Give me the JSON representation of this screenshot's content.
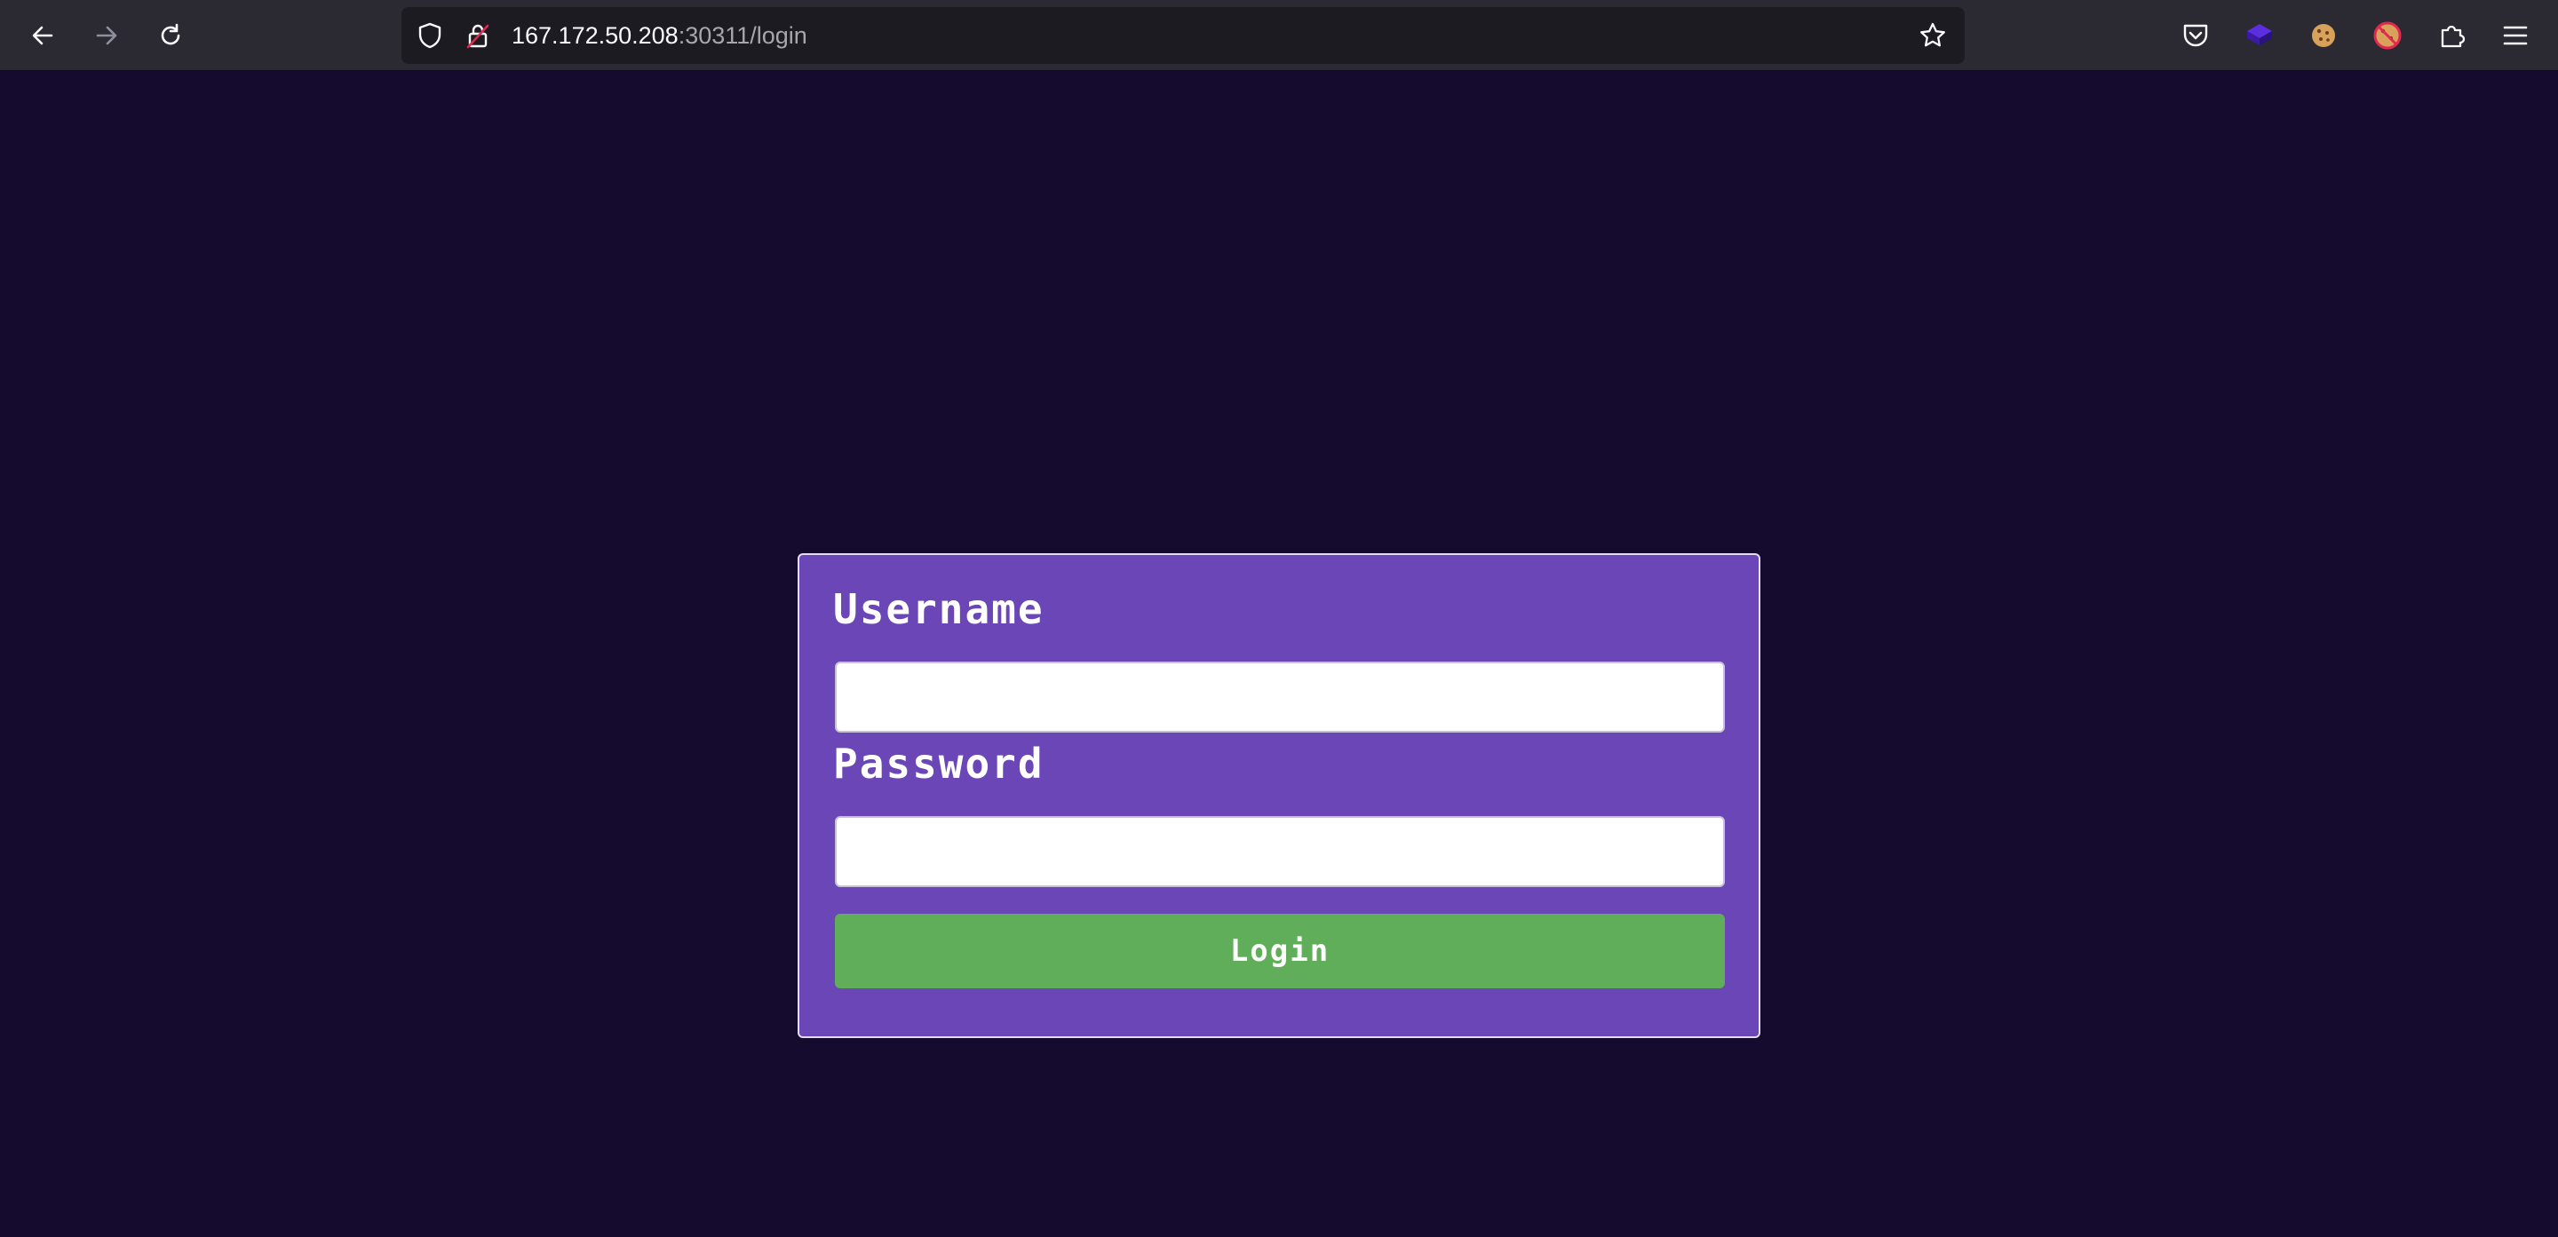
{
  "browser": {
    "url_host": "167.172.50.208",
    "url_rest": ":30311/login",
    "icons": {
      "back": "back-arrow-icon",
      "forward": "forward-arrow-icon",
      "reload": "reload-icon",
      "shield": "tracking-protection-shield-icon",
      "lock": "insecure-lock-icon",
      "bookmark": "bookmark-star-icon",
      "pocket": "pocket-icon",
      "extensions": [
        "extension-cube-icon",
        "cookie-icon",
        "cookie-blocked-icon",
        "extensions-puzzle-icon"
      ],
      "menu": "hamburger-menu-icon"
    }
  },
  "login": {
    "username_label": "Username",
    "username_value": "",
    "password_label": "Password",
    "password_value": "",
    "button_label": "Login"
  },
  "colors": {
    "page_background": "#150b2f",
    "card_background": "#6a46b7",
    "button_background": "#61ae5a"
  }
}
